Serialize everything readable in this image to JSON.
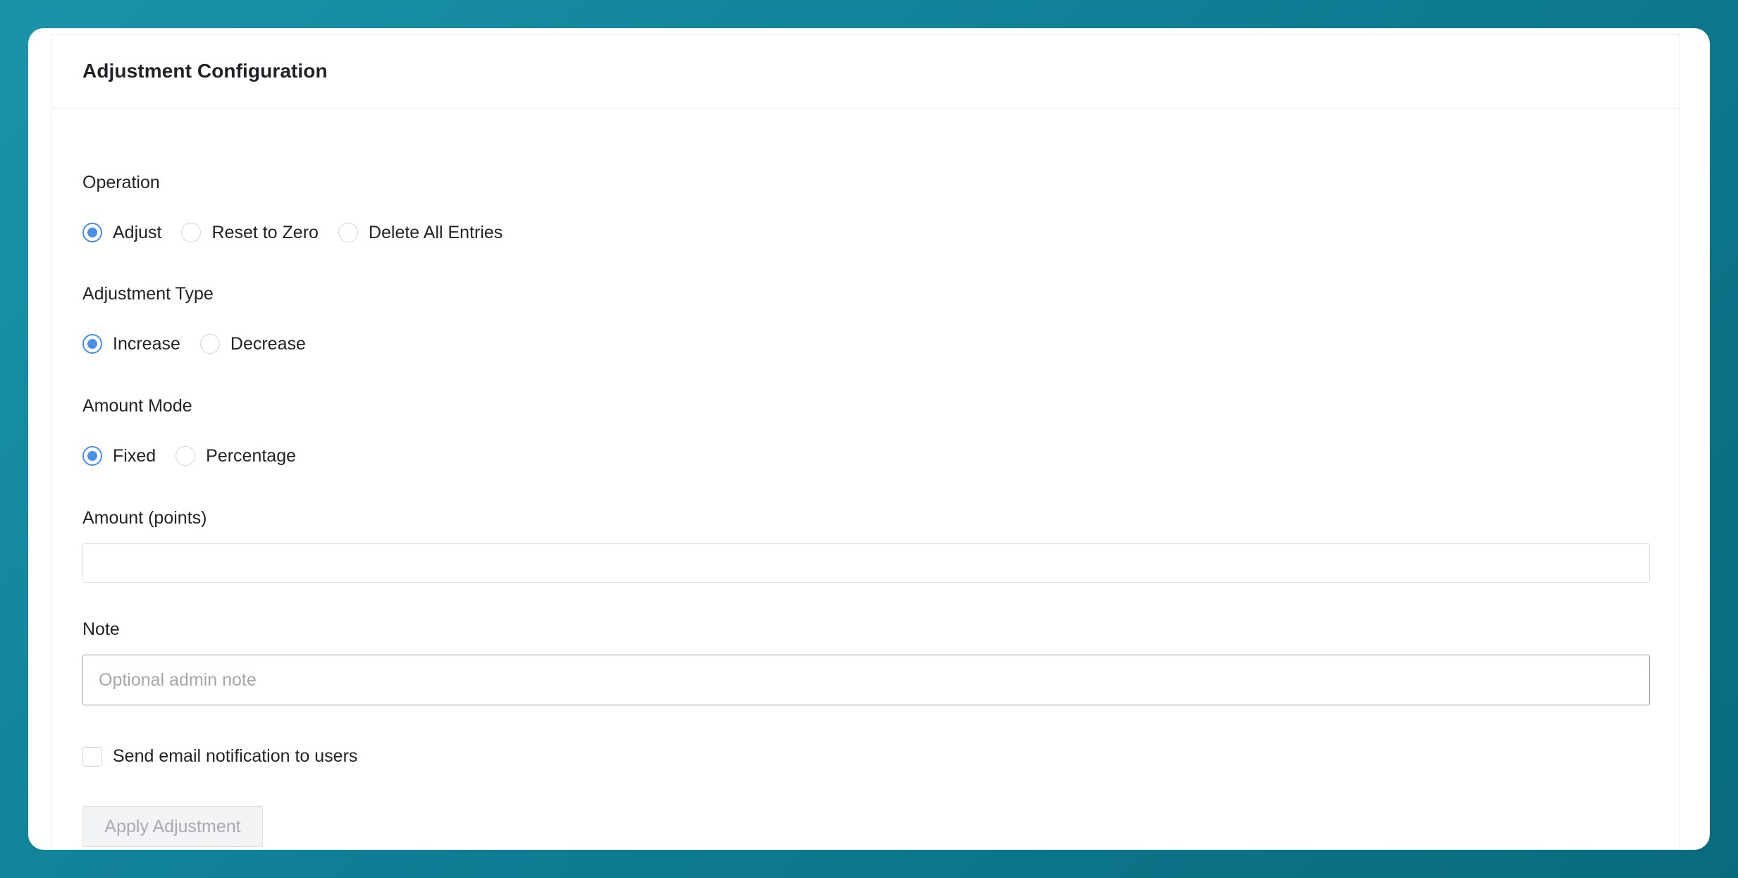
{
  "card": {
    "title": "Adjustment Configuration"
  },
  "operation": {
    "label": "Operation",
    "options": [
      "Adjust",
      "Reset to Zero",
      "Delete All Entries"
    ],
    "selected": "Adjust"
  },
  "adjustment_type": {
    "label": "Adjustment Type",
    "options": [
      "Increase",
      "Decrease"
    ],
    "selected": "Increase"
  },
  "amount_mode": {
    "label": "Amount Mode",
    "options": [
      "Fixed",
      "Percentage"
    ],
    "selected": "Fixed"
  },
  "amount": {
    "label": "Amount (points)",
    "value": "",
    "placeholder": ""
  },
  "note": {
    "label": "Note",
    "value": "",
    "placeholder": "Optional admin note"
  },
  "email_notification": {
    "label": "Send email notification to users",
    "checked": false
  },
  "apply_button": {
    "label": "Apply Adjustment",
    "disabled": true
  },
  "colors": {
    "accent": "#4a90e2",
    "background_gradient_start": "#1a93a8",
    "background_gradient_end": "#0a6a7d",
    "disabled_text": "#a8acb0"
  }
}
